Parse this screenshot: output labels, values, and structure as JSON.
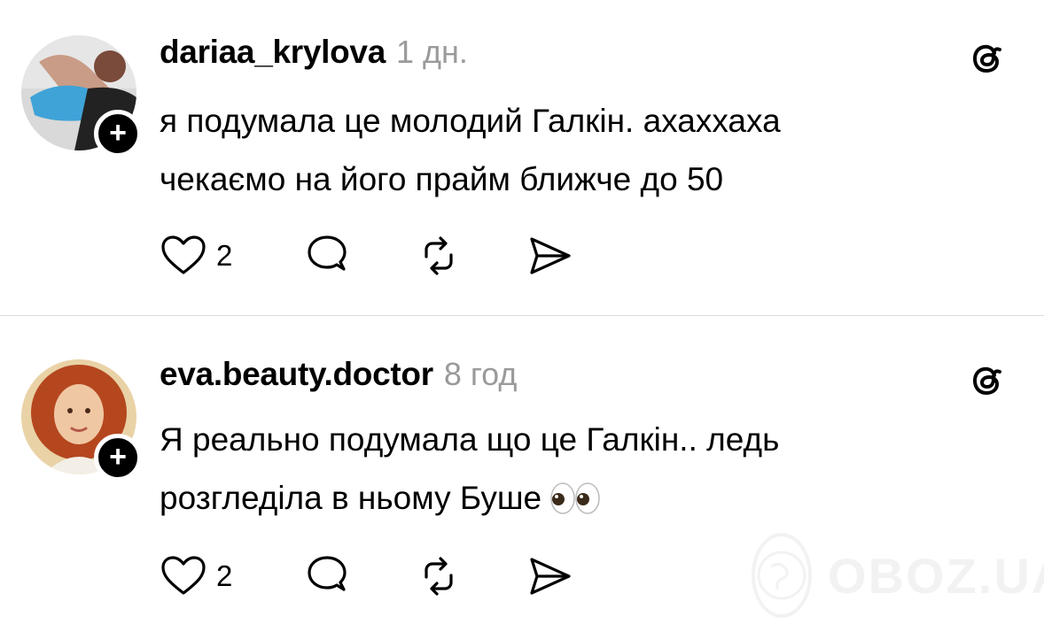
{
  "posts": [
    {
      "username": "dariaa_krylova",
      "time": "1 дн.",
      "text_lines": [
        "я подумала це молодий Галкін. ахаххаха",
        "чекаємо на його прайм ближче до 50"
      ],
      "likes": "2",
      "follow_label": "+"
    },
    {
      "username": "eva.beauty.doctor",
      "time": "8 год",
      "text_lines": [
        "Я реально подумала що це Галкін.. ледь",
        "розгледіла в ньому Буше"
      ],
      "likes": "2",
      "follow_label": "+"
    }
  ],
  "icons": {
    "like": "heart-icon",
    "reply": "comment-icon",
    "repost": "repost-icon",
    "share": "share-icon",
    "platform": "threads-icon",
    "emoji": "eyes-emoji"
  },
  "watermark": {
    "text": "OBOZ.UA"
  },
  "colors": {
    "text": "#000000",
    "muted": "#9a9a9a",
    "divider": "#dcdcdc",
    "background": "#ffffff"
  }
}
